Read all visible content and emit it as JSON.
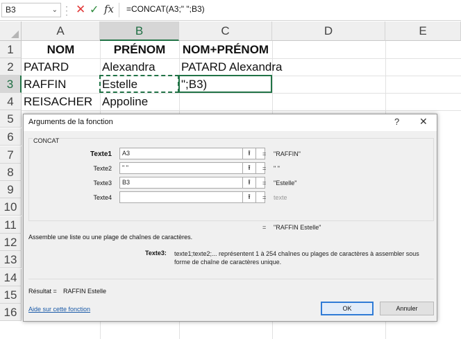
{
  "formula_bar": {
    "name_box": "B3",
    "cancel_icon": "✕",
    "enter_icon": "✓",
    "fx_label": "fx",
    "formula": "=CONCAT(A3;\" \";B3)"
  },
  "columns": [
    "A",
    "B",
    "C",
    "D",
    "E"
  ],
  "rows": [
    "1",
    "2",
    "3",
    "4",
    "5",
    "6",
    "7",
    "8",
    "9",
    "10",
    "11",
    "12",
    "13",
    "14",
    "15",
    "16"
  ],
  "cells": {
    "A1": "NOM",
    "B1": "PRÉNOM",
    "C1": "NOM+PRÉNOM",
    "A2": "PATARD",
    "B2": "Alexandra",
    "C2": "PATARD Alexandra",
    "A3": "RAFFIN",
    "B3": "Estelle",
    "C3": "\";B3)",
    "A4": "REISACHER",
    "B4": "Appoline"
  },
  "dialog": {
    "title": "Arguments de la fonction",
    "help_button": "?",
    "close_button": "✕",
    "function_name": "CONCAT",
    "args": [
      {
        "label": "Texte1",
        "value": "A3",
        "result": "\"RAFFIN\""
      },
      {
        "label": "Texte2",
        "value": "\" \"",
        "result": "\" \""
      },
      {
        "label": "Texte3",
        "value": "B3",
        "result": "\"Estelle\""
      },
      {
        "label": "Texte4",
        "value": "",
        "result": "texte"
      }
    ],
    "equals": "=",
    "total_result": "\"RAFFIN Estelle\"",
    "description": "Assemble une liste ou une plage de chaînes de caractères.",
    "help_label": "Texte3:",
    "help_text": "texte1;texte2;... représentent 1 à 254 chaînes ou plages de caractères à assembler sous forme de chaîne de caractères unique.",
    "result_label": "Résultat =",
    "result_value": "RAFFIN Estelle",
    "help_link": "Aide sur cette fonction",
    "ok_label": "OK",
    "cancel_label": "Annuler"
  }
}
